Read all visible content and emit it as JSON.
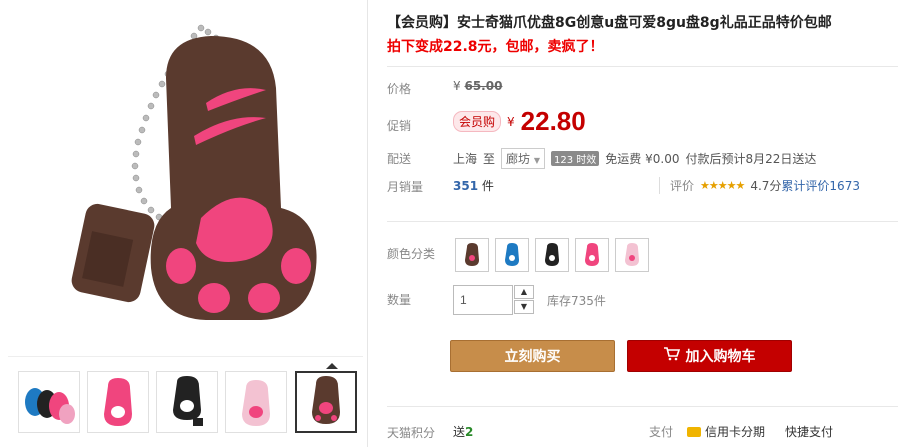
{
  "title": "【会员购】安士奇猫爪优盘8G创意u盘可爱8gu盘8g礼品正品特价包邮",
  "subtitle": "拍下变成22.8元，包邮，卖疯了！",
  "price": {
    "label": "价格",
    "currency": "¥",
    "original": "65.00"
  },
  "promo": {
    "label": "促销",
    "badge": "会员购",
    "currency": "¥",
    "value": "22.80"
  },
  "delivery": {
    "label": "配送",
    "from": "上海",
    "to_word": "至",
    "destination": "廊坊",
    "time_badge": "123 时效",
    "fee": "免运费 ¥0.00",
    "eta": "付款后预计8月22日送达"
  },
  "sales": {
    "label": "月销量",
    "count": "351",
    "unit": "件",
    "review_label": "评价",
    "stars": "★★★★★",
    "score": "4.7分",
    "total": "累计评价1673"
  },
  "color": {
    "label": "颜色分类",
    "swatches": [
      "#5a3a2e",
      "#1e7ac2",
      "#222222",
      "#f0457e",
      "#f0a2c0"
    ]
  },
  "quantity": {
    "label": "数量",
    "value": "1",
    "stock": "库存735件"
  },
  "buttons": {
    "buy_now": "立刻购买",
    "add_cart": "加入购物车"
  },
  "footer": {
    "points_label": "天猫积分",
    "points_prefix": "送",
    "points_value": "2",
    "pay_label": "支付",
    "pay_credit": "信用卡分期",
    "pay_quick": "快捷支付"
  },
  "colors": {
    "accent_red": "#c40000",
    "gold": "#c78d4a",
    "paw_brown": "#5a3a2e",
    "paw_pink": "#f0457e"
  }
}
